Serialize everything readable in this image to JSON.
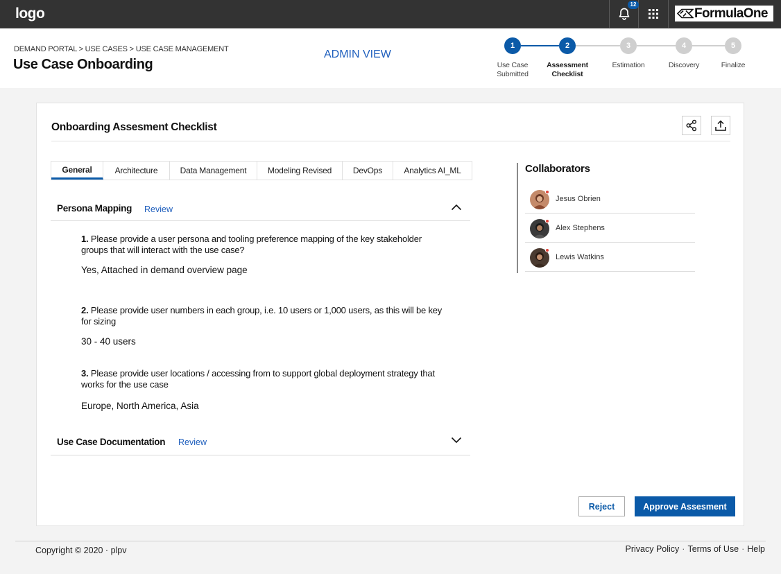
{
  "topbar": {
    "logo": "logo",
    "notification_count": "12",
    "brand": "FormulaOne",
    "icons": [
      "bell-icon",
      "apps-grid-icon",
      "formulaone-logo-icon"
    ]
  },
  "header": {
    "breadcrumb": "DEMAND PORTAL > USE CASES > USE CASE MANAGEMENT",
    "title": "Use Case Onboarding",
    "admin_view": "ADMIN VIEW"
  },
  "stepper": {
    "active_color": "#0b5aa8",
    "inactive_color": "#cfcfcf",
    "steps": [
      {
        "number": "1",
        "label_line1": "Use Case",
        "label_line2": "Submitted",
        "state": "complete"
      },
      {
        "number": "2",
        "label_line1": "Assessment",
        "label_line2": "Checklist",
        "state": "active"
      },
      {
        "number": "3",
        "label_line1": "Estimation",
        "label_line2": "",
        "state": "pending"
      },
      {
        "number": "4",
        "label_line1": "Discovery",
        "label_line2": "",
        "state": "pending"
      },
      {
        "number": "5",
        "label_line1": "Finalize",
        "label_line2": "",
        "state": "pending"
      }
    ]
  },
  "card": {
    "title": "Onboarding Assesment Checklist",
    "actions": [
      "share-icon",
      "upload-icon"
    ]
  },
  "tabs": [
    {
      "label": "General",
      "active": true
    },
    {
      "label": "Architecture",
      "active": false
    },
    {
      "label": "Data Management",
      "active": false
    },
    {
      "label": "Modeling Revised",
      "active": false
    },
    {
      "label": "DevOps",
      "active": false
    },
    {
      "label": "Analytics AI_ML",
      "active": false
    }
  ],
  "sections": [
    {
      "title": "Persona Mapping",
      "review": "Review",
      "expanded": true,
      "questions": [
        {
          "number": "1.",
          "text": "Please provide a user persona and tooling preference mapping of the key stakeholder groups that will interact with the use case?",
          "answer": "Yes, Attached in demand overview page"
        },
        {
          "number": "2.",
          "text": "Please provide user numbers in each group, i.e. 10 users or 1,000 users, as this will be key for sizing",
          "answer": "30 - 40 users"
        },
        {
          "number": "3.",
          "text": "Please provide user locations / accessing from to support global deployment strategy that works for the use case",
          "answer": "Europe, North America, Asia"
        }
      ]
    },
    {
      "title": "Use Case Documentation",
      "review": "Review",
      "expanded": false,
      "questions": []
    }
  ],
  "collaborators": {
    "title": "Collaborators",
    "people": [
      {
        "name": "Jesus Obrien",
        "online": true
      },
      {
        "name": "Alex Stephens",
        "online": true
      },
      {
        "name": "Lewis Watkins",
        "online": true
      }
    ]
  },
  "actions": {
    "reject": "Reject",
    "approve": "Approve Assesment"
  },
  "footer": {
    "copyright": "Copyright © 2020 · plpv",
    "links": [
      "Privacy Policy",
      "Terms of Use",
      "Help"
    ]
  }
}
